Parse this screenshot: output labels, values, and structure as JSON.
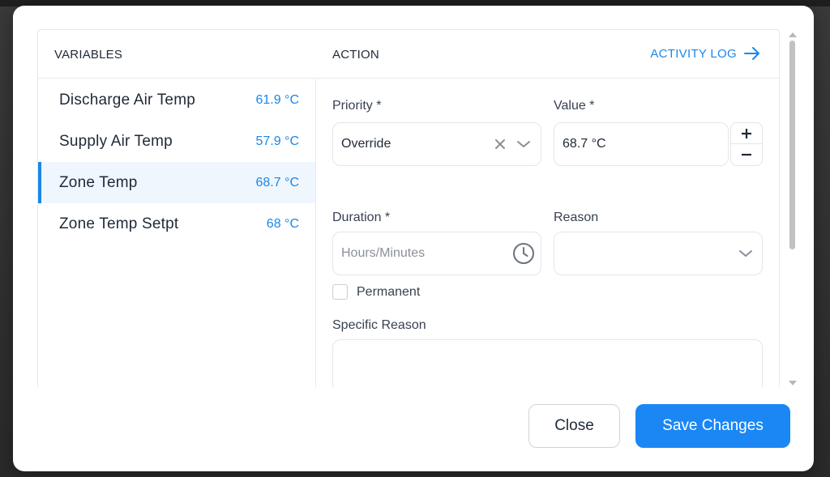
{
  "variables_panel": {
    "header": "VARIABLES",
    "items": [
      {
        "name": "Discharge Air Temp",
        "value": "61.9 °C",
        "active": false
      },
      {
        "name": "Supply Air Temp",
        "value": "57.9 °C",
        "active": false
      },
      {
        "name": "Zone Temp",
        "value": "68.7 °C",
        "active": true
      },
      {
        "name": "Zone Temp Setpt",
        "value": "68 °C",
        "active": false
      }
    ]
  },
  "action_panel": {
    "header": "ACTION",
    "activity_log_label": "ACTIVITY LOG",
    "priority": {
      "label": "Priority *",
      "value": "Override"
    },
    "value_field": {
      "label": "Value *",
      "value": "68.7 °C",
      "increment": "+",
      "decrement": "−"
    },
    "duration": {
      "label": "Duration *",
      "placeholder": "Hours/Minutes"
    },
    "reason": {
      "label": "Reason",
      "value": ""
    },
    "permanent": {
      "label": "Permanent",
      "checked": false
    },
    "specific_reason": {
      "label": "Specific Reason",
      "value": ""
    }
  },
  "footer": {
    "close_label": "Close",
    "save_label": "Save Changes"
  },
  "colors": {
    "accent": "#1a87e8",
    "primary_button": "#1a87f5",
    "active_row_bg": "#f0f6fd"
  }
}
